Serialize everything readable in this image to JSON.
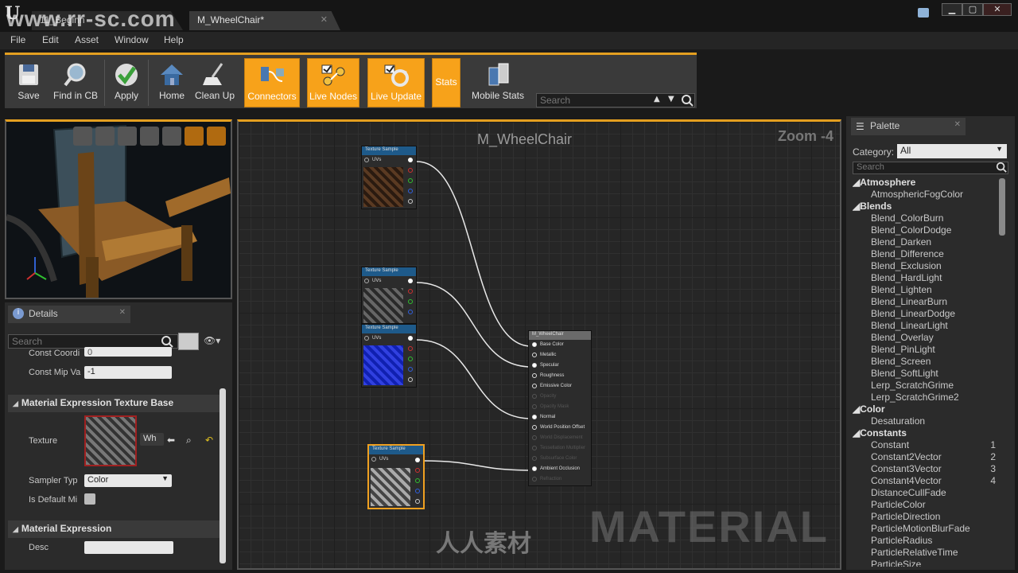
{
  "window": {
    "tabs": [
      {
        "label": "11_Beginn"
      },
      {
        "label": "M_WheelChair*"
      }
    ],
    "watermark": "www.rr-sc.com",
    "controls": {
      "minimize": "▁",
      "maximize": "▢",
      "close": "✕"
    }
  },
  "menu": [
    "File",
    "Edit",
    "Asset",
    "Window",
    "Help"
  ],
  "toolbar": {
    "save": "Save",
    "find_in_cb": "Find in CB",
    "apply": "Apply",
    "home": "Home",
    "clean_up": "Clean Up",
    "connectors": "Connectors",
    "live_nodes": "Live Nodes",
    "live_update": "Live Update",
    "stats": "Stats",
    "mobile_stats": "Mobile Stats",
    "search_placeholder": "Search",
    "accent": "#f7a21a"
  },
  "details": {
    "tab": "Details",
    "search_placeholder": "Search",
    "props": {
      "const_coord_label": "Const Coordi",
      "const_coord_value": "0",
      "const_mip_label": "Const Mip Va",
      "const_mip_value": "-1"
    },
    "section_texture_base": "Material Expression Texture Base",
    "texture_label": "Texture",
    "texture_value": "Wh",
    "sampler_label": "Sampler Typ",
    "sampler_value": "Color",
    "is_default_label": "Is Default Mi",
    "section_expression": "Material Expression",
    "desc_label": "Desc",
    "desc_value": ""
  },
  "graph": {
    "title": "M_WheelChair",
    "zoom": "Zoom -4",
    "watermark": "MATERIAL",
    "logo_text": "人人素材",
    "texture_node_title": "Texture Sample",
    "uvs_label": "UVs",
    "result_node": {
      "title": "M_WheelChair",
      "pins": [
        "Base Color",
        "Metallic",
        "Specular",
        "Roughness",
        "Emissive Color",
        "Opacity",
        "Opacity Mask",
        "Normal",
        "World Position Offset",
        "World Displacement",
        "Tessellation Multiplier",
        "Subsurface Color",
        "Ambient Occlusion",
        "Refraction"
      ]
    }
  },
  "palette": {
    "tab": "Palette",
    "category_label": "Category:",
    "category_value": "All",
    "search_placeholder": "Search",
    "groups": [
      {
        "name": "Atmosphere",
        "items": [
          {
            "name": "AtmosphericFogColor",
            "shortcut": ""
          }
        ]
      },
      {
        "name": "Blends",
        "items": [
          {
            "name": "Blend_ColorBurn",
            "shortcut": ""
          },
          {
            "name": "Blend_ColorDodge",
            "shortcut": ""
          },
          {
            "name": "Blend_Darken",
            "shortcut": ""
          },
          {
            "name": "Blend_Difference",
            "shortcut": ""
          },
          {
            "name": "Blend_Exclusion",
            "shortcut": ""
          },
          {
            "name": "Blend_HardLight",
            "shortcut": ""
          },
          {
            "name": "Blend_Lighten",
            "shortcut": ""
          },
          {
            "name": "Blend_LinearBurn",
            "shortcut": ""
          },
          {
            "name": "Blend_LinearDodge",
            "shortcut": ""
          },
          {
            "name": "Blend_LinearLight",
            "shortcut": ""
          },
          {
            "name": "Blend_Overlay",
            "shortcut": ""
          },
          {
            "name": "Blend_PinLight",
            "shortcut": ""
          },
          {
            "name": "Blend_Screen",
            "shortcut": ""
          },
          {
            "name": "Blend_SoftLight",
            "shortcut": ""
          },
          {
            "name": "Lerp_ScratchGrime",
            "shortcut": ""
          },
          {
            "name": "Lerp_ScratchGrime2",
            "shortcut": ""
          }
        ]
      },
      {
        "name": "Color",
        "items": [
          {
            "name": "Desaturation",
            "shortcut": ""
          }
        ]
      },
      {
        "name": "Constants",
        "items": [
          {
            "name": "Constant",
            "shortcut": "1"
          },
          {
            "name": "Constant2Vector",
            "shortcut": "2"
          },
          {
            "name": "Constant3Vector",
            "shortcut": "3"
          },
          {
            "name": "Constant4Vector",
            "shortcut": "4"
          },
          {
            "name": "DistanceCullFade",
            "shortcut": ""
          },
          {
            "name": "ParticleColor",
            "shortcut": ""
          },
          {
            "name": "ParticleDirection",
            "shortcut": ""
          },
          {
            "name": "ParticleMotionBlurFade",
            "shortcut": ""
          },
          {
            "name": "ParticleRadius",
            "shortcut": ""
          },
          {
            "name": "ParticleRelativeTime",
            "shortcut": ""
          },
          {
            "name": "ParticleSize",
            "shortcut": ""
          }
        ]
      }
    ]
  }
}
